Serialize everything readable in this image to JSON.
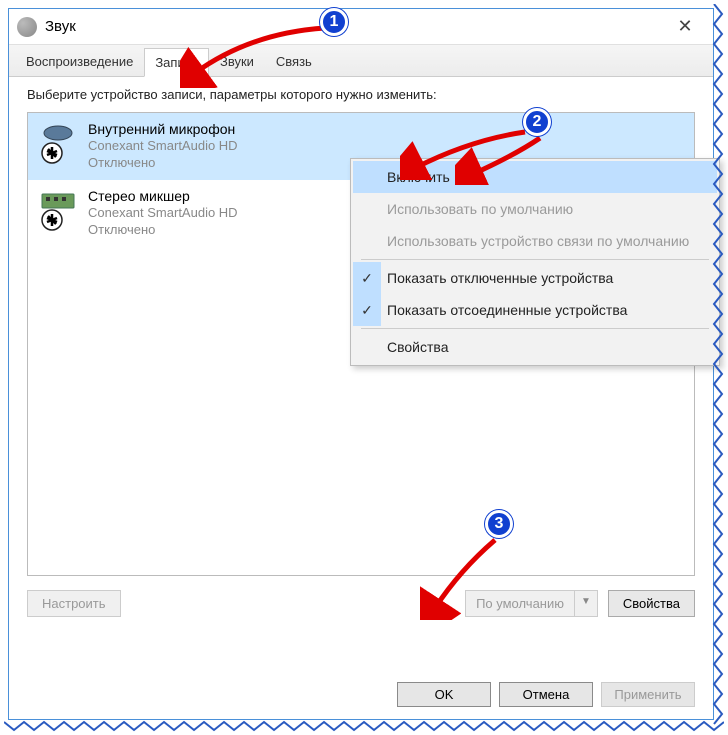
{
  "window": {
    "title": "Звук"
  },
  "tabs": {
    "playback": "Воспроизведение",
    "recording": "Запись",
    "sounds": "Звуки",
    "communications": "Связь"
  },
  "instruction": "Выберите устройство записи, параметры которого нужно изменить:",
  "devices": [
    {
      "name": "Внутренний микрофон",
      "driver": "Conexant SmartAudio HD",
      "status": "Отключено"
    },
    {
      "name": "Стерео микшер",
      "driver": "Conexant SmartAudio HD",
      "status": "Отключено"
    }
  ],
  "context_menu": {
    "enable": "Включить",
    "set_default": "Использовать по умолчанию",
    "set_default_comm": "Использовать устройство связи по умолчанию",
    "show_disabled": "Показать отключенные устройства",
    "show_disconnected": "Показать отсоединенные устройства",
    "properties": "Свойства"
  },
  "buttons": {
    "configure": "Настроить",
    "set_default": "По умолчанию",
    "properties": "Свойства",
    "ok": "OK",
    "cancel": "Отмена",
    "apply": "Применить"
  },
  "badges": {
    "b1": "1",
    "b2": "2",
    "b3": "3"
  }
}
